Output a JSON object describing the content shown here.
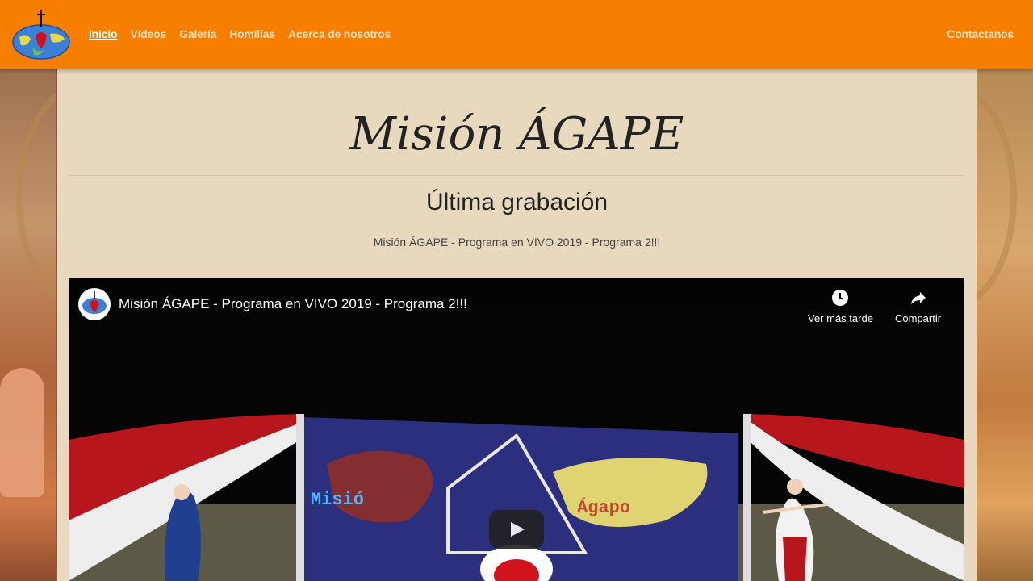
{
  "nav": {
    "logo": "logo-icon",
    "links": [
      "Inicio",
      "Vídeos",
      "Galería",
      "Homilías",
      "Acerca de nosotros"
    ],
    "active_link": "Inicio",
    "contact": "Contactanos"
  },
  "main": {
    "title": "Misión ÁGAPE",
    "section_heading": "Última grabación",
    "section_subtitle": "Misión ÁGAPE - Programa en VIVO 2019 - Programa 2!!!"
  },
  "video": {
    "title": "Misión ÁGAPE - Programa en VIVO 2019 - Programa 2!!!",
    "watch_later": "Ver más tarde",
    "share": "Compartir",
    "play_icon": "youtube-play-icon"
  },
  "colors": {
    "navbar": "#f77f00",
    "nav_text": "#f6ddb5",
    "panel": "#e8d8bd"
  }
}
